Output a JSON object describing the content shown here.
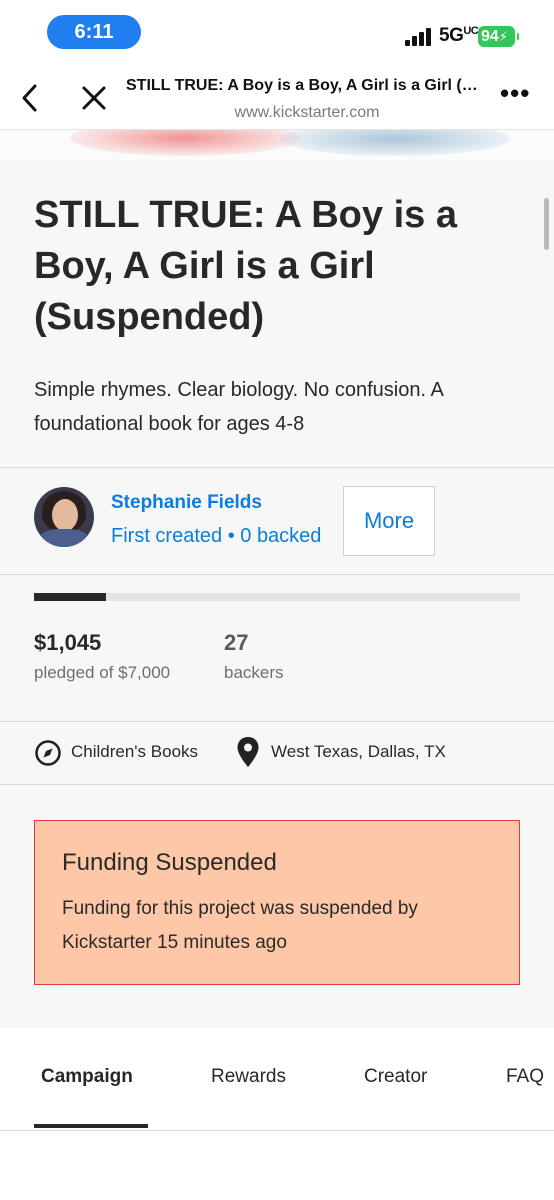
{
  "status_bar": {
    "time": "6:11",
    "network": "5G",
    "network_suffix": "UC",
    "battery": "94"
  },
  "browser": {
    "title": "STILL TRUE: A Boy is a Boy, A Girl is a Girl (Suspended)",
    "url": "www.kickstarter.com",
    "icons": [
      "chevron-left-icon",
      "close-icon",
      "more-dots-icon"
    ]
  },
  "project": {
    "title": "STILL TRUE: A Boy is a Boy, A Girl is a Girl (Suspended)",
    "blurb": "Simple rhymes. Clear biology. No confusion. A foundational book for ages 4-8"
  },
  "creator": {
    "name": "Stephanie Fields",
    "meta": "First created • 0 backed",
    "more_label": "More"
  },
  "funding": {
    "progress_fraction": 0.149,
    "pledged": "$1,045",
    "pledged_label": "pledged of $7,000",
    "backers": "27",
    "backers_label": "backers"
  },
  "details": {
    "category": "Children's Books",
    "location": "West Texas, Dallas, TX"
  },
  "suspension": {
    "title": "Funding Suspended",
    "text": "Funding for this project was suspended by Kickstarter 15 minutes ago"
  },
  "tabs": [
    "Campaign",
    "Rewards",
    "Creator",
    "FAQ"
  ],
  "colors": {
    "link_blue": "#0a7ee0",
    "status_pill": "#1f7ef0",
    "battery_green": "#33c759",
    "suspended_bg": "#fec8a8",
    "suspended_border": "#e43a3a"
  }
}
